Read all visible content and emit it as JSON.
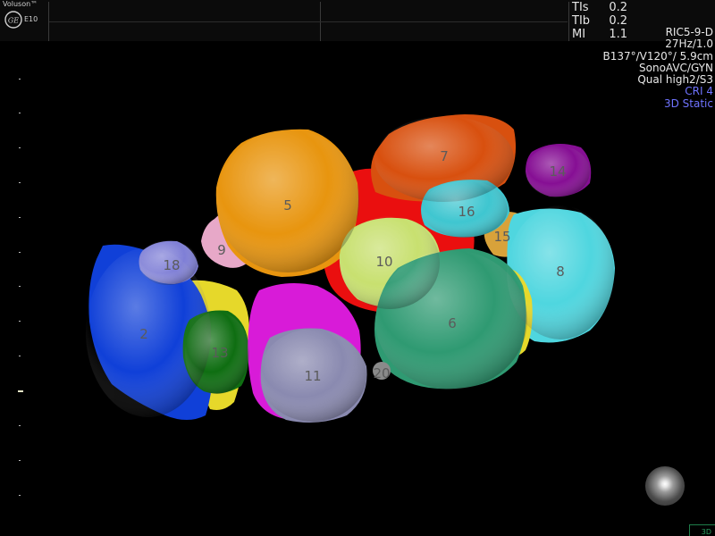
{
  "header": {
    "brand": "Voluson™",
    "model": "E10",
    "logo_icon": "ge-logo-icon",
    "acoustic": [
      {
        "label": "TIs",
        "value": "0.2"
      },
      {
        "label": "TIb",
        "value": "0.2"
      },
      {
        "label": "MI",
        "value": "1.1"
      }
    ]
  },
  "info_panel": {
    "probe": "RIC5-9-D",
    "frame_rate": "27Hz/1.0",
    "volume": "B137°/V120°/ 5.9cm",
    "mode": "SonoAVC/GYN",
    "quality": "Qual high2/S3",
    "cri": "CRI 4",
    "render_mode": "3D Static",
    "accent_color": "#6f73ff"
  },
  "volumes": [
    {
      "id": "2",
      "color": "#1040d8"
    },
    {
      "id": "5",
      "color": "#e8950f"
    },
    {
      "id": "6",
      "color": "#2f9a72"
    },
    {
      "id": "7",
      "color": "#d8500f"
    },
    {
      "id": "8",
      "color": "#4fd6df"
    },
    {
      "id": "9",
      "color": "#e7a8c8"
    },
    {
      "id": "10",
      "color": "#c8e070"
    },
    {
      "id": "11",
      "color": "#8a8ab0"
    },
    {
      "id": "13",
      "color": "#0f6e12"
    },
    {
      "id": "14",
      "color": "#860f94"
    },
    {
      "id": "15",
      "color": "#d8a23a"
    },
    {
      "id": "16",
      "color": "#3fc6d0"
    },
    {
      "id": "18",
      "color": "#7f7fd6"
    },
    {
      "id": "20",
      "color": "#8a8a8a"
    }
  ],
  "footer": {
    "corner_label": "3D",
    "orientation_icon": "orientation-sphere-icon"
  }
}
